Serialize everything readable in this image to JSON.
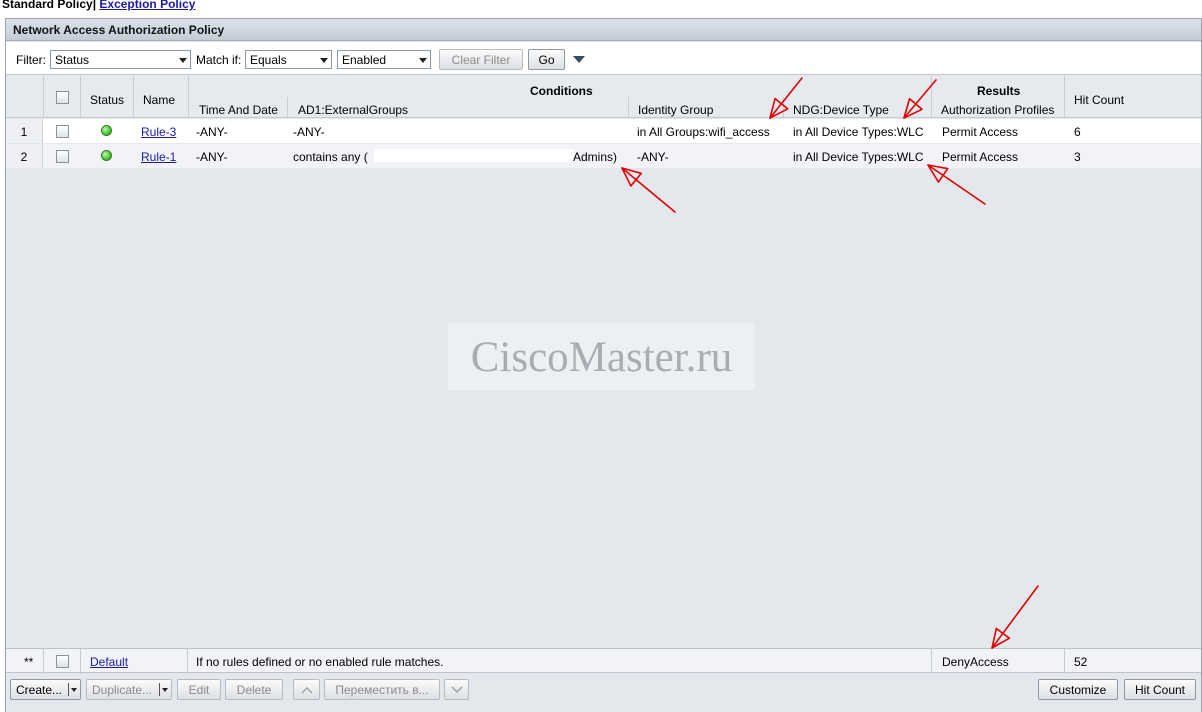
{
  "tabs": {
    "standard": "Standard Policy",
    "separator": "|",
    "exception": "Exception Policy"
  },
  "panel": {
    "title": "Network Access Authorization Policy"
  },
  "filter": {
    "label": "Filter:",
    "field_value": "Status",
    "match_label": "Match if:",
    "match_value": "Equals",
    "value": "Enabled",
    "clear_label": "Clear Filter",
    "go_label": "Go"
  },
  "columns": {
    "status": "Status",
    "name": "Name",
    "conditions": "Conditions",
    "time_and_date": "Time And Date",
    "ad_groups": "AD1:ExternalGroups",
    "identity_group": "Identity Group",
    "device_type": "NDG:Device Type",
    "results": "Results",
    "auth_profiles": "Authorization Profiles",
    "hit_count": "Hit Count"
  },
  "rules": [
    {
      "num": "1",
      "name": "Rule-3",
      "time": "-ANY-",
      "ad_groups": "-ANY-",
      "identity_group": "in All Groups:wifi_access",
      "device_type": "in All Device Types:WLC",
      "profile": "Permit Access",
      "hits": "6"
    },
    {
      "num": "2",
      "name": "Rule-1",
      "time": "-ANY-",
      "ad_groups_prefix": "contains any (",
      "ad_groups_suffix": "Admins)",
      "identity_group": "-ANY-",
      "device_type": "in All Device Types:WLC",
      "profile": "Permit Access",
      "hits": "3"
    }
  ],
  "default_rule": {
    "marker": "**",
    "name": "Default",
    "description": "If no rules defined or no enabled rule matches.",
    "profile": "DenyAccess",
    "hits": "52"
  },
  "watermark": "CiscoMaster.ru",
  "buttons": {
    "create": "Create...",
    "duplicate": "Duplicate...",
    "edit": "Edit",
    "delete": "Delete",
    "move": "Переместить в...",
    "customize": "Customize",
    "hit_count": "Hit Count"
  },
  "colors": {
    "annotation_arrow": "#e00000",
    "link": "#1a1aa6",
    "status_enabled": "#4fcc3a"
  }
}
